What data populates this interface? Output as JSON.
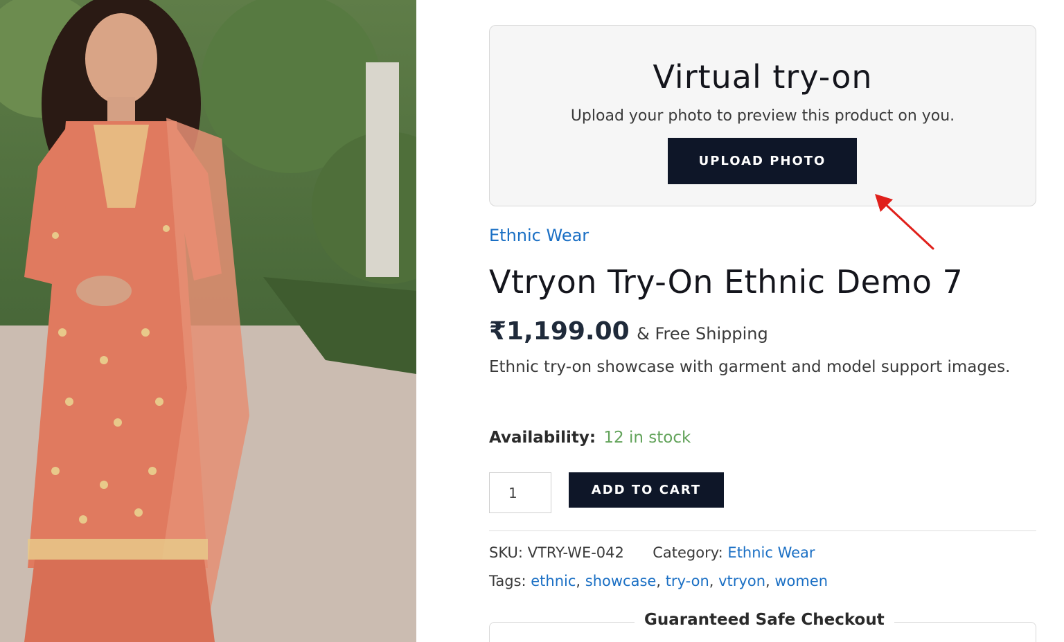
{
  "product_image": {
    "alt": "Model wearing an orange embroidered kurta with dupatta",
    "colors": {
      "garment": "#e07a5f",
      "embroidery": "#e8c98a",
      "foliage": "#4d6b3c",
      "path": "#c9b8ad"
    }
  },
  "tryon": {
    "title": "Virtual try-on",
    "subtitle": "Upload your photo to preview this product on you.",
    "upload_label": "UPLOAD PHOTO"
  },
  "product": {
    "category": "Ethnic Wear",
    "title": "Vtryon Try-On Ethnic Demo 7",
    "price": "₹1,199.00",
    "shipping": "& Free Shipping",
    "short_description": "Ethnic try-on showcase with garment and model support images.",
    "availability_label": "Availability:",
    "availability_value": "12 in stock",
    "quantity": "1",
    "add_to_cart_label": "ADD TO CART"
  },
  "meta": {
    "sku_label": "SKU:",
    "sku_value": "VTRY-WE-042",
    "category_label": "Category:",
    "category_value": "Ethnic Wear",
    "tags_label": "Tags:",
    "tags": [
      "ethnic",
      "showcase",
      "try-on",
      "vtryon",
      "women"
    ]
  },
  "checkout": {
    "label": "Guaranteed Safe Checkout"
  },
  "colors": {
    "button_bg": "#0e1628",
    "link": "#1a6fc4",
    "in_stock": "#62a35a",
    "annotation_arrow": "#e0201b"
  }
}
